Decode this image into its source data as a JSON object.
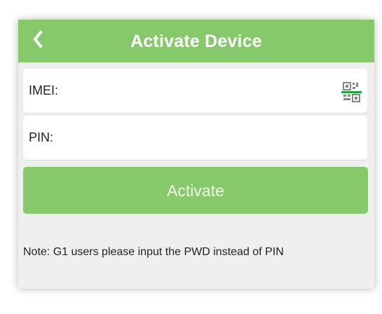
{
  "header": {
    "back_icon": "chevron-left-icon",
    "title": "Activate Device"
  },
  "form": {
    "imei_label": "IMEI:",
    "imei_value": "",
    "scan_icon": "qr-scan-icon",
    "pin_label": "PIN:",
    "pin_value": "",
    "activate_label": "Activate"
  },
  "note": "Note: G1 users please input the PWD instead of PIN",
  "colors": {
    "accent": "#86c96b",
    "background": "#efefef",
    "field_background": "#ffffff",
    "text": "#222222",
    "scan_icon": "#7f8b84",
    "scan_line": "#1aa83a"
  }
}
